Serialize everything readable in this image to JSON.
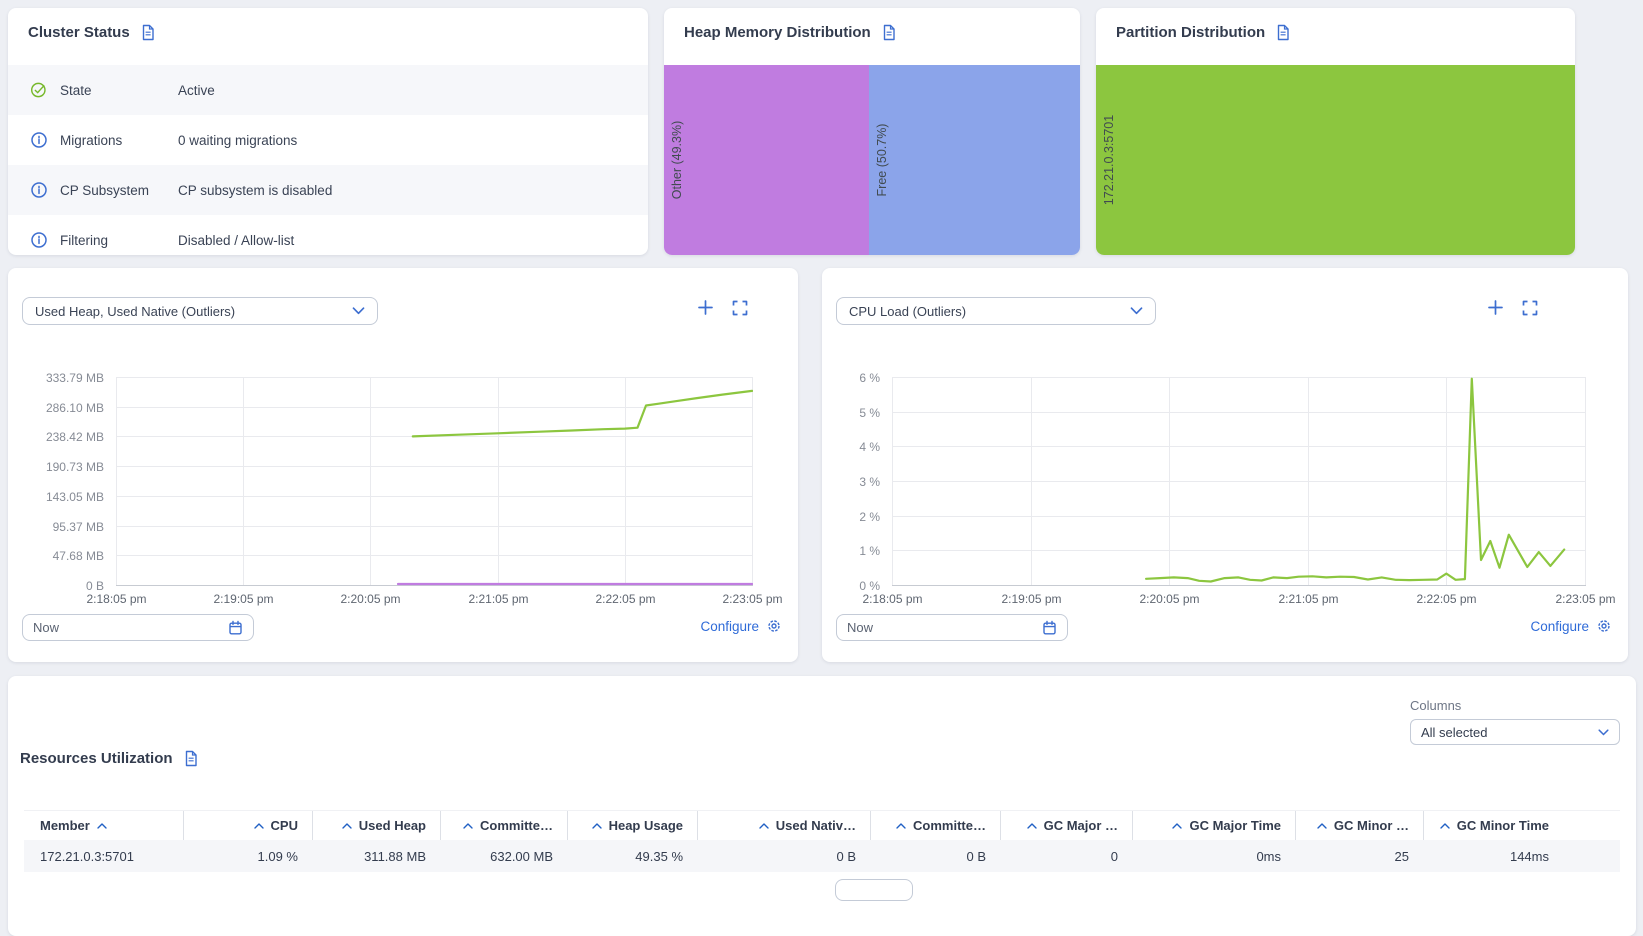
{
  "colors": {
    "accent": "#3d6ed0",
    "link": "#2f6bd8",
    "green_icon": "#76b82a",
    "series_green": "#8cc63f",
    "series_purple": "#c07ce0",
    "bar_blue": "#8ba4ea",
    "sort_caret": "#2160c4"
  },
  "cluster_status": {
    "title": "Cluster Status",
    "rows": [
      {
        "icon": "check-circle-icon",
        "label": "State",
        "value": "Active"
      },
      {
        "icon": "info-circle-icon",
        "label": "Migrations",
        "value": "0 waiting migrations"
      },
      {
        "icon": "info-circle-icon",
        "label": "CP Subsystem",
        "value": "CP subsystem is disabled"
      },
      {
        "icon": "info-circle-icon",
        "label": "Filtering",
        "value": "Disabled / Allow-list"
      }
    ]
  },
  "heap_memory_distribution": {
    "title": "Heap Memory Distribution",
    "segments": [
      {
        "label": "Other (49.3%)",
        "percent": 49.3,
        "color": "#c07ce0"
      },
      {
        "label": "Free (50.7%)",
        "percent": 50.7,
        "color": "#8ba4ea"
      }
    ]
  },
  "partition_distribution": {
    "title": "Partition Distribution",
    "segments": [
      {
        "label": "172.21.0.3:5701",
        "percent": 100,
        "color": "#8cc63f"
      }
    ]
  },
  "left_chart_panel": {
    "selector_value": "Used Heap, Used Native (Outliers)",
    "time_input_value": "Now",
    "configure_label": "Configure"
  },
  "right_chart_panel": {
    "selector_value": "CPU Load (Outliers)",
    "time_input_value": "Now",
    "configure_label": "Configure"
  },
  "chart_data": [
    {
      "type": "line",
      "title": "Used Heap, Used Native (Outliers)",
      "x_ticks": [
        "2:18:05 pm",
        "2:19:05 pm",
        "2:20:05 pm",
        "2:21:05 pm",
        "2:22:05 pm",
        "2:23:05 pm"
      ],
      "x_range_seconds": [
        0,
        300
      ],
      "y_ticks": [
        "333.79 MB",
        "286.10 MB",
        "238.42 MB",
        "190.73 MB",
        "143.05 MB",
        "95.37 MB",
        "47.68 MB",
        "0 B"
      ],
      "y_max": 333.79,
      "y_unit": "MB",
      "grid": true,
      "legend": "none",
      "series": [
        {
          "name": "Used Heap",
          "color": "#8cc63f",
          "points": [
            [
              140,
              238.5
            ],
            [
              160,
              241
            ],
            [
              180,
              243.5
            ],
            [
              200,
              246
            ],
            [
              215,
              248
            ],
            [
              230,
              250
            ],
            [
              240,
              251
            ],
            [
              246,
              252.5
            ],
            [
              250,
              288
            ],
            [
              256,
              291
            ],
            [
              264,
              295
            ],
            [
              274,
              300
            ],
            [
              286,
              305.5
            ],
            [
              300,
              311.5
            ]
          ]
        },
        {
          "name": "Used Native",
          "color": "#c07ce0",
          "points": [
            [
              133,
              0
            ],
            [
              300,
              0
            ]
          ]
        }
      ]
    },
    {
      "type": "line",
      "title": "CPU Load (Outliers)",
      "x_ticks": [
        "2:18:05 pm",
        "2:19:05 pm",
        "2:20:05 pm",
        "2:21:05 pm",
        "2:22:05 pm",
        "2:23:05 pm"
      ],
      "x_range_seconds": [
        0,
        300
      ],
      "y_ticks": [
        "6 %",
        "5 %",
        "4 %",
        "3 %",
        "2 %",
        "1 %",
        "0 %"
      ],
      "y_max": 6,
      "y_unit": "%",
      "grid": true,
      "legend": "none",
      "series": [
        {
          "name": "CPU Load",
          "color": "#8cc63f",
          "points": [
            [
              110,
              0.18
            ],
            [
              116,
              0.2
            ],
            [
              122,
              0.22
            ],
            [
              128,
              0.2
            ],
            [
              133,
              0.12
            ],
            [
              138,
              0.1
            ],
            [
              144,
              0.2
            ],
            [
              150,
              0.22
            ],
            [
              155,
              0.15
            ],
            [
              160,
              0.13
            ],
            [
              165,
              0.22
            ],
            [
              171,
              0.2
            ],
            [
              176,
              0.24
            ],
            [
              182,
              0.25
            ],
            [
              188,
              0.22
            ],
            [
              194,
              0.24
            ],
            [
              200,
              0.23
            ],
            [
              206,
              0.16
            ],
            [
              212,
              0.22
            ],
            [
              218,
              0.15
            ],
            [
              224,
              0.14
            ],
            [
              230,
              0.15
            ],
            [
              236,
              0.16
            ],
            [
              240,
              0.33
            ],
            [
              244,
              0.15
            ],
            [
              248,
              0.17
            ],
            [
              251,
              5.95
            ],
            [
              255,
              0.72
            ],
            [
              259,
              1.27
            ],
            [
              263,
              0.5
            ],
            [
              267,
              1.45
            ],
            [
              275,
              0.52
            ],
            [
              280,
              0.95
            ],
            [
              285,
              0.55
            ],
            [
              291,
              1.02
            ]
          ]
        }
      ]
    }
  ],
  "resources_utilization": {
    "title": "Resources Utilization",
    "columns_label": "Columns",
    "columns_selected_value": "All selected",
    "headers": [
      {
        "label": "Member",
        "caret": "after"
      },
      {
        "label": "CPU",
        "caret": "before"
      },
      {
        "label": "Used Heap",
        "caret": "before"
      },
      {
        "label": "Committe…",
        "caret": "before"
      },
      {
        "label": "Heap Usage",
        "caret": "before"
      },
      {
        "label": "Used Nativ…",
        "caret": "before"
      },
      {
        "label": "Committe…",
        "caret": "before"
      },
      {
        "label": "GC Major …",
        "caret": "before"
      },
      {
        "label": "GC Major Time",
        "caret": "before"
      },
      {
        "label": "GC Minor …",
        "caret": "before"
      },
      {
        "label": "GC Minor Time",
        "caret": "before"
      }
    ],
    "rows": [
      [
        "172.21.0.3:5701",
        "1.09 %",
        "311.88 MB",
        "632.00 MB",
        "49.35 %",
        "0 B",
        "0 B",
        "0",
        "0ms",
        "25",
        "144ms"
      ]
    ]
  }
}
